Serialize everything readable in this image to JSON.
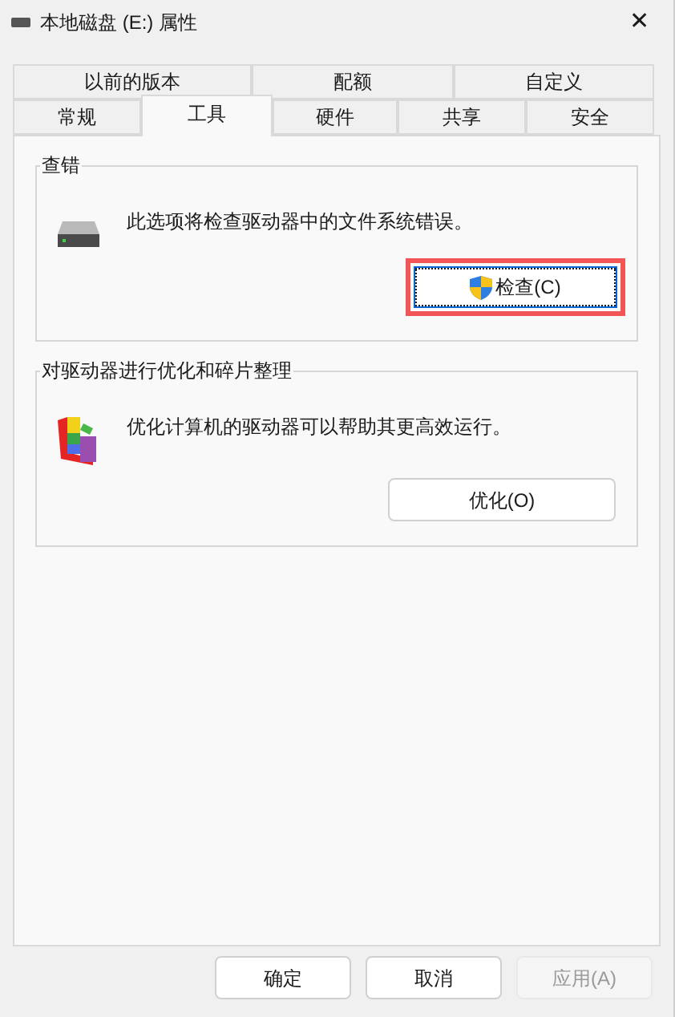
{
  "window": {
    "title": "本地磁盘 (E:) 属性",
    "close": "✕"
  },
  "tab_rows": [
    {
      "tabs": [
        {
          "label": "以前的版本",
          "selected": false
        },
        {
          "label": "配额",
          "selected": false
        },
        {
          "label": "自定义",
          "selected": false
        }
      ]
    },
    {
      "tabs": [
        {
          "label": "常规",
          "selected": false
        },
        {
          "label": "工具",
          "selected": true
        },
        {
          "label": "硬件",
          "selected": false
        },
        {
          "label": "共享",
          "selected": false
        },
        {
          "label": "安全",
          "selected": false
        }
      ]
    }
  ],
  "groups": [
    {
      "kind": "check",
      "title": "查错",
      "description": "此选项将检查驱动器中的文件系统错误。",
      "button": {
        "label": "检查(C)",
        "highlighted": true,
        "shield": true
      }
    },
    {
      "kind": "optimize",
      "title": "对驱动器进行优化和碎片整理",
      "description": "优化计算机的驱动器可以帮助其更高效运行。",
      "button": {
        "label": "优化(O)",
        "highlighted": false,
        "shield": false
      }
    }
  ],
  "buttons": [
    {
      "label": "确定",
      "disabled": false
    },
    {
      "label": "取消",
      "disabled": false
    },
    {
      "label": "应用(A)",
      "disabled": true
    }
  ]
}
